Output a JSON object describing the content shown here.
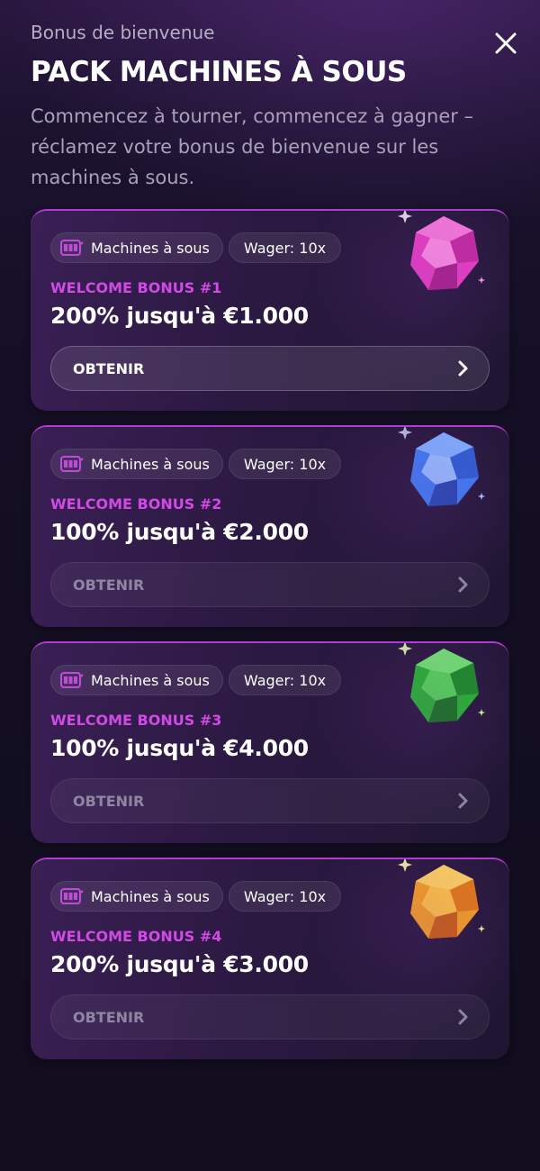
{
  "header": {
    "subtitle": "Bonus de bienvenue",
    "title": "PACK MACHINES À SOUS",
    "description": "Commencez à tourner, commencez à gagner – réclamez votre bonus de bienvenue sur les machines à sous.",
    "close_icon": "close-icon"
  },
  "cards": [
    {
      "category": "Machines à sous",
      "wager": "Wager: 10x",
      "label": "WELCOME BONUS #1",
      "amount": "200% jusqu'à €1.000",
      "button": "OBTENIR",
      "button_state": "active",
      "gem_color": "#e83fc0",
      "icon": "slot-machine-icon"
    },
    {
      "category": "Machines à sous",
      "wager": "Wager: 10x",
      "label": "WELCOME BONUS #2",
      "amount": "100% jusqu'à €2.000",
      "button": "OBTENIR",
      "button_state": "disabled",
      "gem_color": "#3b7cf0",
      "icon": "slot-machine-icon"
    },
    {
      "category": "Machines à sous",
      "wager": "Wager: 10x",
      "label": "WELCOME BONUS #3",
      "amount": "100% jusqu'à €4.000",
      "button": "OBTENIR",
      "button_state": "disabled",
      "gem_color": "#22b52a",
      "icon": "slot-machine-icon"
    },
    {
      "category": "Machines à sous",
      "wager": "Wager: 10x",
      "label": "WELCOME BONUS #4",
      "amount": "200% jusqu'à €3.000",
      "button": "OBTENIR",
      "button_state": "disabled",
      "gem_color": "#f3a01c",
      "icon": "slot-machine-icon"
    }
  ],
  "colors": {
    "accent": "#d24ae6",
    "background": "#140f24"
  }
}
